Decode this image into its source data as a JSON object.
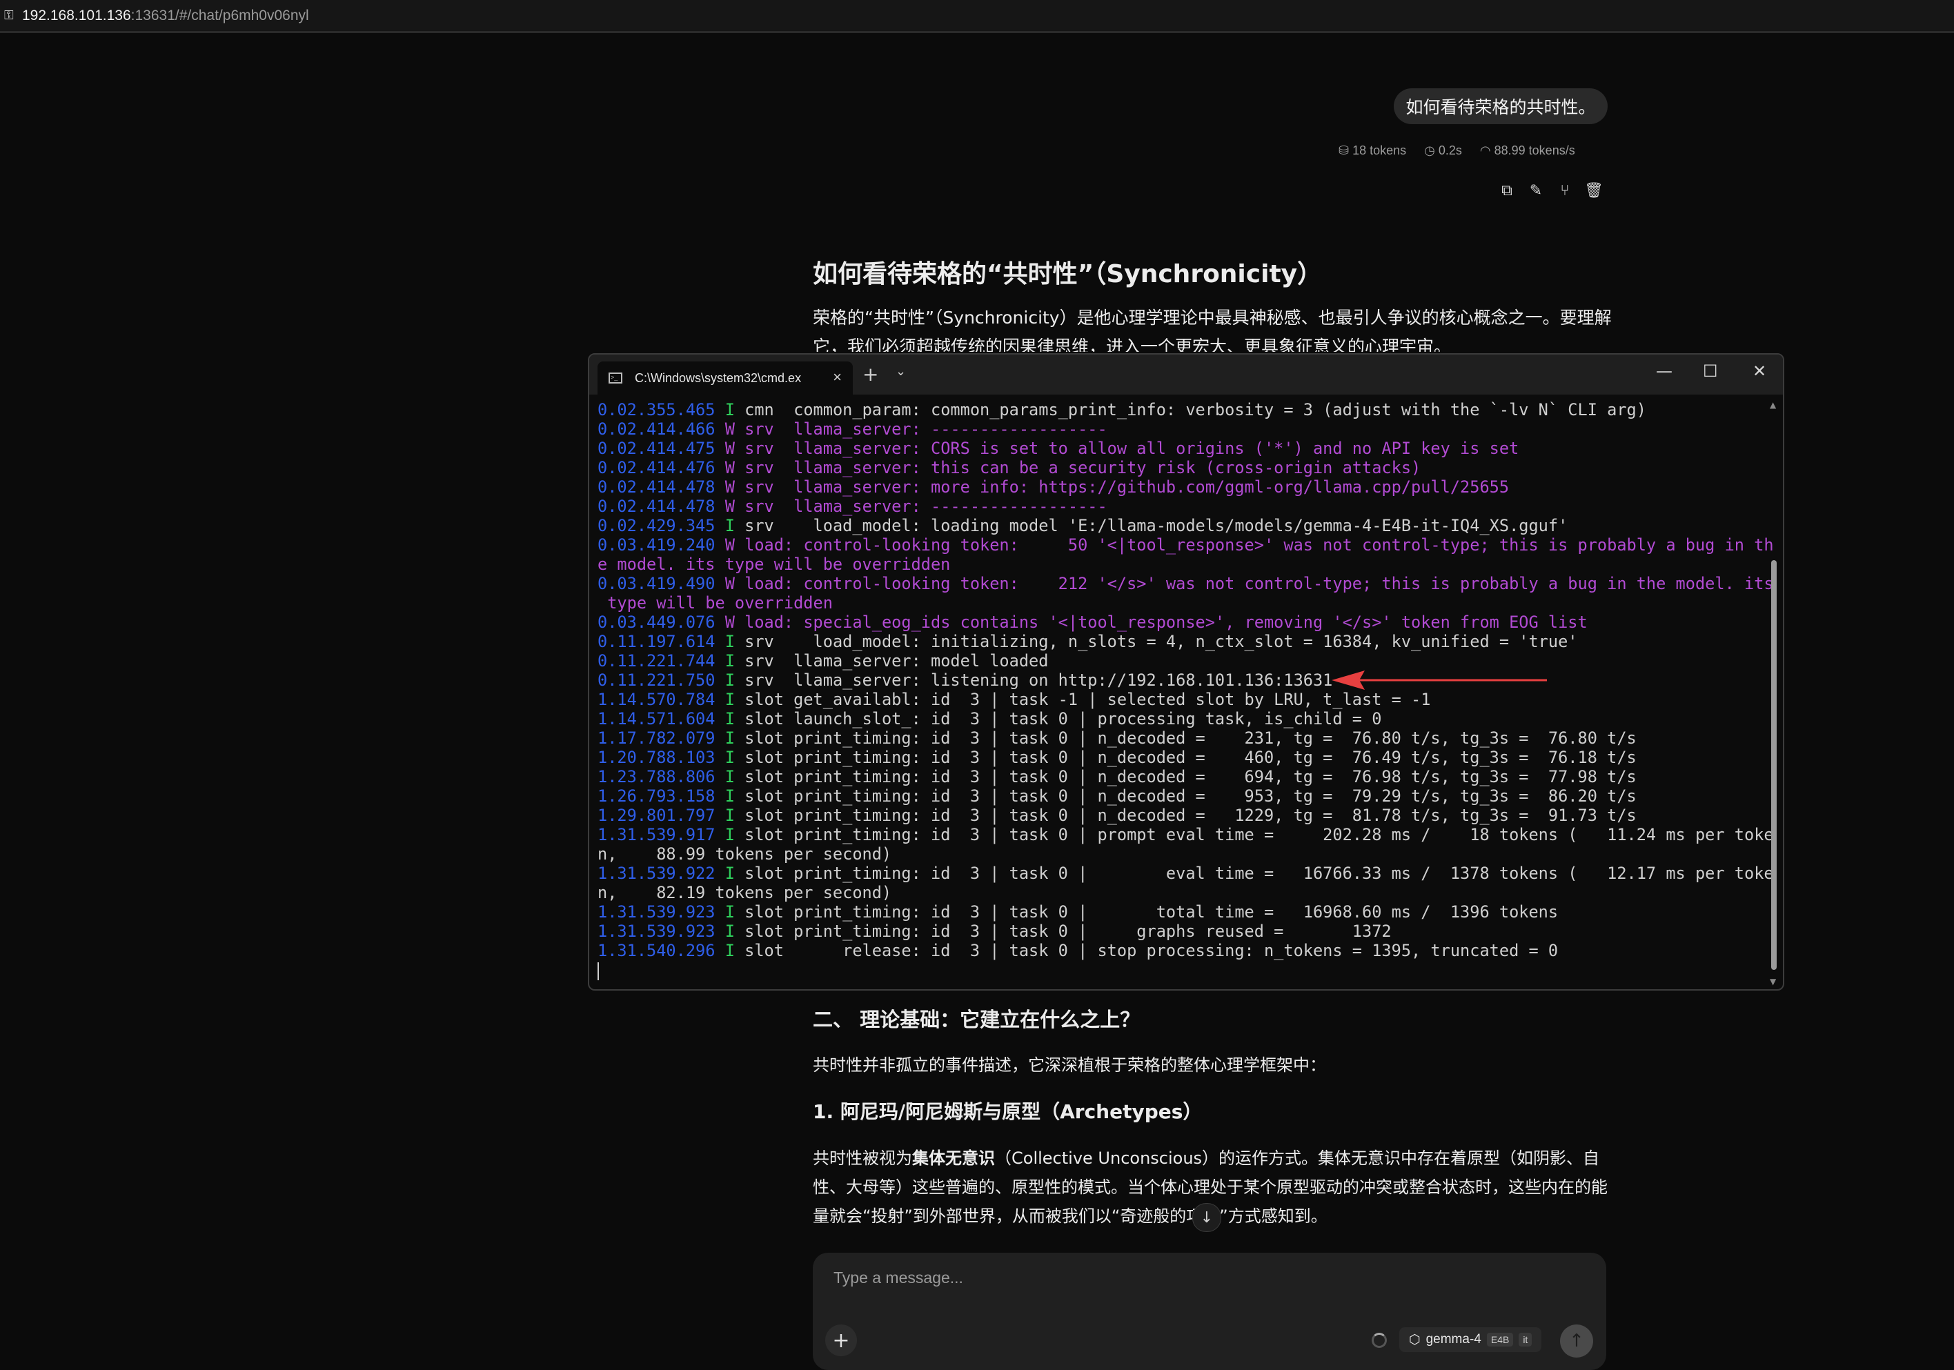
{
  "address_bar": {
    "host": "192.168.101.136",
    "path": ":13631/#/chat/p6mh0v06nyl"
  },
  "user_message": {
    "text": "如何看待荣格的共时性。",
    "stats": {
      "tokens": "18 tokens",
      "time": "0.2s",
      "speed": "88.99 tokens/s"
    }
  },
  "assistant": {
    "heading": "如何看待荣格的“共时性”（Synchronicity）",
    "intro": "荣格的“共时性”（Synchronicity）是他心理学理论中最具神秘感、也最引人争议的核心概念之一。要理解它，我们必须超越传统的因果律思维，进入一个更宏大、更具象征意义的心理宇宙。",
    "section2_title": "二、 理论基础：它建立在什么之上？",
    "section2_text": "共时性并非孤立的事件描述，它深深植根于荣格的整体心理学框架中：",
    "sub1_title": "1. 阿尼玛/阿尼姆斯与原型（Archetypes）",
    "sub1_pre": "共时性被视为",
    "sub1_bold": "集体无意识",
    "sub1_post": "（Collective Unconscious）的运作方式。集体无意识中存在着原型（如阴影、自性、大母等）这些普遍的、原型性的模式。当个体心理处于某个原型驱动的冲突或整合状态时，这些内在的能量就会“投射”到外部世界，从而被我们以“奇迹般的巧合”方式感知到。"
  },
  "composer": {
    "placeholder": "Type a message...",
    "model_name": "gemma-4",
    "model_tag1": "E4B",
    "model_tag2": "it"
  },
  "terminal": {
    "tab_title": "C:\\Windows\\system32\\cmd.ex",
    "lines": [
      {
        "ts": "0.02.355.465",
        "lv": "I",
        "kind": "info",
        "text": " cmn  common_param: common_params_print_info: verbosity = 3 (adjust with the `-lv N` CLI arg)"
      },
      {
        "ts": "0.02.414.466",
        "lv": "W",
        "kind": "warn",
        "text": " srv  llama_server: ------------------"
      },
      {
        "ts": "0.02.414.475",
        "lv": "W",
        "kind": "warn",
        "text": " srv  llama_server: CORS is set to allow all origins ('*') and no API key is set"
      },
      {
        "ts": "0.02.414.476",
        "lv": "W",
        "kind": "warn",
        "text": " srv  llama_server: this can be a security risk (cross-origin attacks)"
      },
      {
        "ts": "0.02.414.478",
        "lv": "W",
        "kind": "warn",
        "text": " srv  llama_server: more info: https://github.com/ggml-org/llama.cpp/pull/25655"
      },
      {
        "ts": "0.02.414.478",
        "lv": "W",
        "kind": "warn",
        "text": " srv  llama_server: ------------------"
      },
      {
        "ts": "0.02.429.345",
        "lv": "I",
        "kind": "info",
        "text": " srv    load_model: loading model 'E:/llama-models/models/gemma-4-E4B-it-IQ4_XS.gguf'"
      },
      {
        "ts": "0.03.419.240",
        "lv": "W",
        "kind": "warn",
        "text": " load: control-looking token:     50 '<|tool_response>' was not control-type; this is probably a bug in th"
      },
      {
        "ts": "",
        "lv": "",
        "kind": "warn",
        "text": "e model. its type will be overridden"
      },
      {
        "ts": "0.03.419.490",
        "lv": "W",
        "kind": "warn",
        "text": " load: control-looking token:    212 '</s>' was not control-type; this is probably a bug in the model. its"
      },
      {
        "ts": "",
        "lv": "",
        "kind": "warn",
        "text": " type will be overridden"
      },
      {
        "ts": "0.03.449.076",
        "lv": "W",
        "kind": "warn",
        "text": " load: special_eog_ids contains '<|tool_response>', removing '</s>' token from EOG list"
      },
      {
        "ts": "0.11.197.614",
        "lv": "I",
        "kind": "info",
        "text": " srv    load_model: initializing, n_slots = 4, n_ctx_slot = 16384, kv_unified = 'true'"
      },
      {
        "ts": "0.11.221.744",
        "lv": "I",
        "kind": "info",
        "text": " srv  llama_server: model loaded"
      },
      {
        "ts": "0.11.221.750",
        "lv": "I",
        "kind": "info",
        "text": " srv  llama_server: listening on http://192.168.101.136:13631"
      },
      {
        "ts": "1.14.570.784",
        "lv": "I",
        "kind": "info",
        "text": " slot get_availabl: id  3 | task -1 | selected slot by LRU, t_last = -1"
      },
      {
        "ts": "1.14.571.604",
        "lv": "I",
        "kind": "info",
        "text": " slot launch_slot_: id  3 | task 0 | processing task, is_child = 0"
      },
      {
        "ts": "1.17.782.079",
        "lv": "I",
        "kind": "info",
        "text": " slot print_timing: id  3 | task 0 | n_decoded =    231, tg =  76.80 t/s, tg_3s =  76.80 t/s"
      },
      {
        "ts": "1.20.788.103",
        "lv": "I",
        "kind": "info",
        "text": " slot print_timing: id  3 | task 0 | n_decoded =    460, tg =  76.49 t/s, tg_3s =  76.18 t/s"
      },
      {
        "ts": "1.23.788.806",
        "lv": "I",
        "kind": "info",
        "text": " slot print_timing: id  3 | task 0 | n_decoded =    694, tg =  76.98 t/s, tg_3s =  77.98 t/s"
      },
      {
        "ts": "1.26.793.158",
        "lv": "I",
        "kind": "info",
        "text": " slot print_timing: id  3 | task 0 | n_decoded =    953, tg =  79.29 t/s, tg_3s =  86.20 t/s"
      },
      {
        "ts": "1.29.801.797",
        "lv": "I",
        "kind": "info",
        "text": " slot print_timing: id  3 | task 0 | n_decoded =   1229, tg =  81.78 t/s, tg_3s =  91.73 t/s"
      },
      {
        "ts": "1.31.539.917",
        "lv": "I",
        "kind": "info",
        "text": " slot print_timing: id  3 | task 0 | prompt eval time =     202.28 ms /    18 tokens (   11.24 ms per toke"
      },
      {
        "ts": "",
        "lv": "",
        "kind": "info",
        "text": "n,    88.99 tokens per second)"
      },
      {
        "ts": "1.31.539.922",
        "lv": "I",
        "kind": "info",
        "text": " slot print_timing: id  3 | task 0 |        eval time =   16766.33 ms /  1378 tokens (   12.17 ms per toke"
      },
      {
        "ts": "",
        "lv": "",
        "kind": "info",
        "text": "n,    82.19 tokens per second)"
      },
      {
        "ts": "1.31.539.923",
        "lv": "I",
        "kind": "info",
        "text": " slot print_timing: id  3 | task 0 |       total time =   16968.60 ms /  1396 tokens"
      },
      {
        "ts": "1.31.539.923",
        "lv": "I",
        "kind": "info",
        "text": " slot print_timing: id  3 | task 0 |     graphs reused =       1372"
      },
      {
        "ts": "1.31.540.296",
        "lv": "I",
        "kind": "info",
        "text": " slot      release: id  3 | task 0 | stop processing: n_tokens = 1395, truncated = 0"
      }
    ]
  },
  "icons": {
    "lock": "page-info-icon",
    "copy": "copy-icon",
    "edit": "edit-icon",
    "branch": "branch-icon",
    "delete": "trash-icon",
    "arrow_color": "#e84040"
  }
}
